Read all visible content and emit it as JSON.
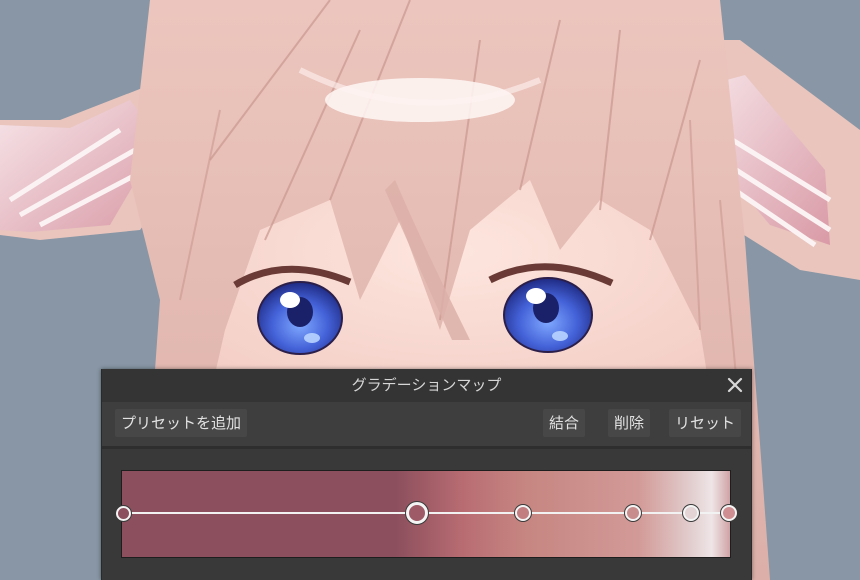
{
  "dialog": {
    "title": "グラデーションマップ",
    "close_icon": "close-icon",
    "toolbar": {
      "add_preset": "プリセットを追加",
      "merge": "結合",
      "delete": "削除",
      "reset": "リセット"
    }
  },
  "gradient": {
    "colors": [
      "#8c4f5d",
      "#b86c72",
      "#c68581",
      "#d29a97",
      "#e3d0d1",
      "#efe5e7",
      "#d0a3a5"
    ],
    "stops": [
      {
        "position": 0.0,
        "color": "#8c4f5d",
        "selected": false
      },
      {
        "position": 0.485,
        "color": "#9e5a66",
        "selected": true
      },
      {
        "position": 0.66,
        "color": "#c27d80",
        "selected": false
      },
      {
        "position": 0.842,
        "color": "#c98c8d",
        "selected": false
      },
      {
        "position": 0.937,
        "color": "#e4d4d6",
        "selected": false
      },
      {
        "position": 1.0,
        "color": "#cf8f92",
        "selected": false
      }
    ]
  },
  "colors": {
    "background": "#8896a5",
    "hair": "#e2bcb4",
    "eye": "#3f58cf"
  }
}
